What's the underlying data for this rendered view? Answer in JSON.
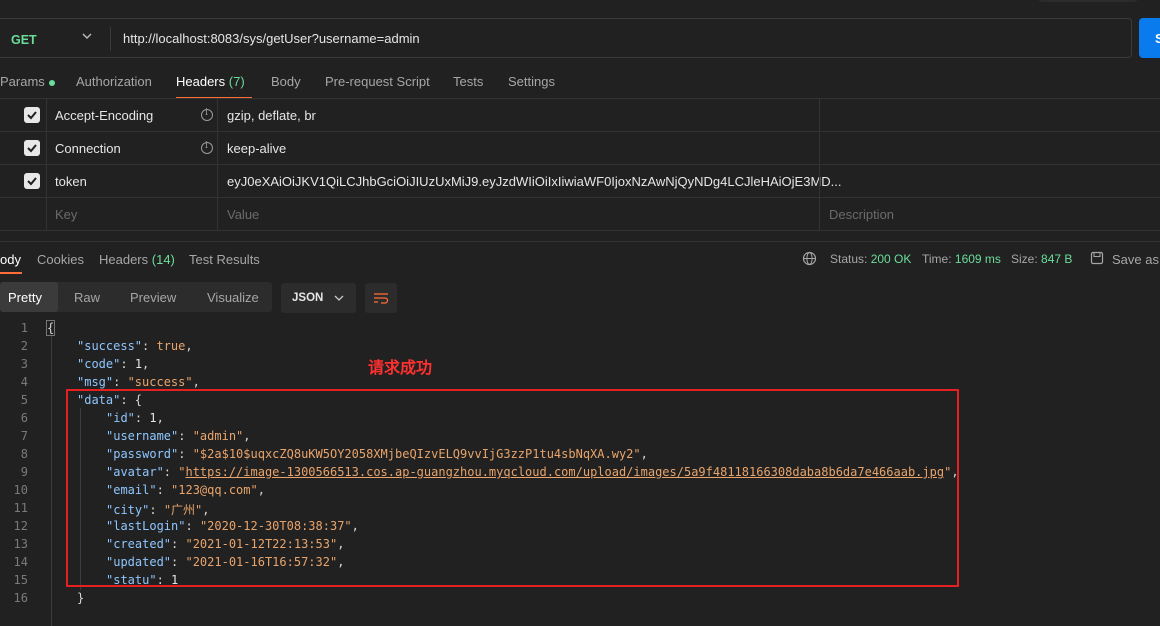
{
  "request": {
    "method": "GET",
    "url": "http://localhost:8083/sys/getUser?username=admin",
    "send_label": "S"
  },
  "request_tabs": [
    {
      "label": "Params"
    },
    {
      "label": "Authorization"
    },
    {
      "label": "Headers",
      "count": "(7)"
    },
    {
      "label": "Body"
    },
    {
      "label": "Pre-request Script"
    },
    {
      "label": "Tests"
    },
    {
      "label": "Settings"
    }
  ],
  "headers": [
    {
      "key": "Accept-Encoding",
      "value": "gzip, deflate, br",
      "checked": true
    },
    {
      "key": "Connection",
      "value": "keep-alive",
      "checked": true
    },
    {
      "key": "token",
      "value": "eyJ0eXAiOiJKV1QiLCJhbGciOiJIUzUxMiJ9.eyJzdWIiOiIxIiwiaWF0IjoxNzAwNjQyNDg4LCJleHAiOjE3MD...",
      "checked": true
    }
  ],
  "headers_placeholder": {
    "key": "Key",
    "value": "Value",
    "description": "Description"
  },
  "response_tabs": [
    {
      "label": "ody"
    },
    {
      "label": "Cookies"
    },
    {
      "label": "Headers",
      "count": "(14)"
    },
    {
      "label": "Test Results"
    }
  ],
  "response_meta": {
    "status_label": "Status:",
    "status_value": "200 OK",
    "time_label": "Time:",
    "time_value": "1609 ms",
    "size_label": "Size:",
    "size_value": "847 B",
    "save_label": "Save as"
  },
  "view_modes": [
    "Pretty",
    "Raw",
    "Preview",
    "Visualize"
  ],
  "format": "JSON",
  "annotation": "请求成功",
  "code_lines": [
    {
      "n": "1"
    },
    {
      "n": "2"
    },
    {
      "n": "3"
    },
    {
      "n": "4"
    },
    {
      "n": "5"
    },
    {
      "n": "6"
    },
    {
      "n": "7"
    },
    {
      "n": "8"
    },
    {
      "n": "9"
    },
    {
      "n": "10"
    },
    {
      "n": "11"
    },
    {
      "n": "12"
    },
    {
      "n": "13"
    },
    {
      "n": "14"
    },
    {
      "n": "15"
    },
    {
      "n": "16"
    }
  ],
  "json_body": {
    "success": "true",
    "code": "1",
    "msg": "\"success\"",
    "data": {
      "id": "1",
      "username": "\"admin\"",
      "password": "\"$2a$10$uqxcZQ8uKW5OY2058XMjbeQIzvELQ9vvIjG3zzP1tu4sbNqXA.wy2\"",
      "avatar": "https://image-1300566513.cos.ap-guangzhou.myqcloud.com/upload/images/5a9f48118166308daba8b6da7e466aab.jpg",
      "email": "\"123@qq.com\"",
      "city": "\"广州\"",
      "lastLogin": "\"2020-12-30T08:38:37\"",
      "created": "\"2021-01-12T22:13:53\"",
      "updated": "\"2021-01-16T16:57:32\"",
      "statu": "1"
    }
  },
  "colors": {
    "accent": "#ff6c37",
    "success": "#6bdd9a",
    "send": "#097bed",
    "json_key": "#8ec6ff",
    "json_string": "#e9a46b",
    "highlight_box": "#e62020"
  }
}
